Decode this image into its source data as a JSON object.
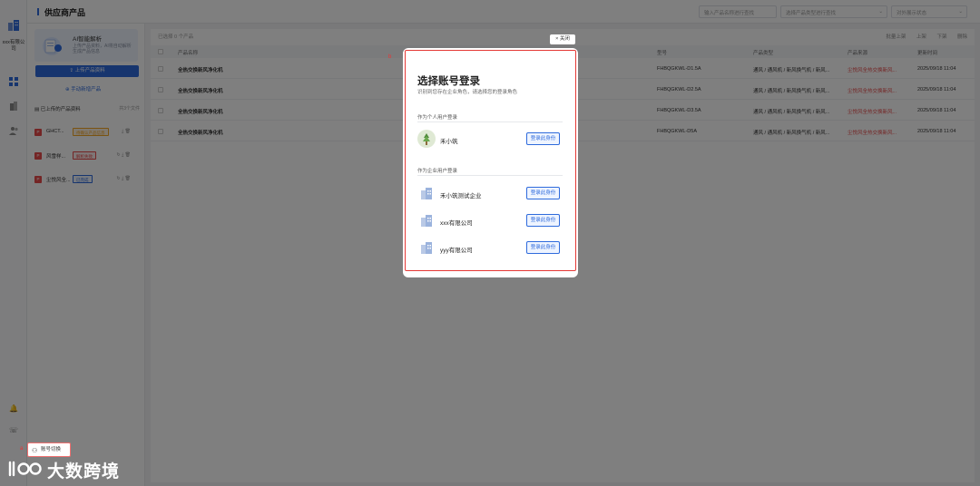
{
  "rail": {
    "org_name": "xxx有限公司"
  },
  "header": {
    "title": "供应商产品",
    "search_placeholder": "输入产品名称进行查找",
    "filter_placeholder": "选择产品类型进行查找",
    "status_placeholder": "对外展示状态"
  },
  "panel": {
    "ai_title": "AI智能解析",
    "ai_desc": "上传产品资料，AI将自动解析生成产品信息",
    "upload_label": "上传产品资料",
    "manual_label": "手动新增产品",
    "list_title": "已上传的产品资料",
    "list_count": "共3个文件",
    "files": [
      {
        "name": "GHCT...",
        "tag": "待确认产品信息",
        "tag_color": "#f5a623"
      },
      {
        "name": "风雪样...",
        "tag": "解析失败",
        "tag_color": "#e84a4a"
      },
      {
        "name": "尘悦风全...",
        "tag": "已完成",
        "tag_color": "#2f6bdc"
      }
    ],
    "switch_label": "账号切换"
  },
  "table": {
    "selected_info": "已选择 0 个产品",
    "actions": [
      "批量上架",
      "上架",
      "下架",
      "删除"
    ],
    "headers": [
      "产品名称",
      "型号",
      "产品类型",
      "产品来源",
      "更新时间"
    ],
    "rows": [
      {
        "name": "全热交换新风净化机",
        "model": "FHBQGKWL-D1.5A",
        "type": "通风 / 通风机 / 新风换气机 / 新风...",
        "source": "尘悦风全热交换新风...",
        "time": "2025/09/18 11:04"
      },
      {
        "name": "全热交换新风净化机",
        "model": "FHBQGKWL-D2.5A",
        "type": "通风 / 通风机 / 新风换气机 / 新风...",
        "source": "尘悦风全热交换新风...",
        "time": "2025/09/18 11:04"
      },
      {
        "name": "全热交换新风净化机",
        "model": "FHBQGKWL-D3.5A",
        "type": "通风 / 通风机 / 新风换气机 / 新风...",
        "source": "尘悦风全热交换新风...",
        "time": "2025/09/18 11:04"
      },
      {
        "name": "全热交换新风净化机",
        "model": "FHBQGKWL-D5A",
        "type": "通风 / 通风机 / 新风换气机 / 新风...",
        "source": "尘悦风全热交换新风...",
        "time": "2025/09/18 11:04"
      }
    ]
  },
  "modal": {
    "close_label": "关闭",
    "title": "选择账号登录",
    "subtitle": "识别到您存在企业角色，请选择您的登录角色",
    "personal_section": "作为个人用户登录",
    "enterprise_section": "作为企业用户登录",
    "login_label": "登录此身份",
    "personal_accounts": [
      {
        "name": "禾小筑"
      }
    ],
    "enterprise_accounts": [
      {
        "name": "禾小筑测试企业"
      },
      {
        "name": "xxx有限公司"
      },
      {
        "name": "yyy有限公司"
      }
    ]
  },
  "watermark": {
    "text": "大数跨境"
  },
  "annotations": {
    "mark_a": "a",
    "mark_b": "b"
  }
}
